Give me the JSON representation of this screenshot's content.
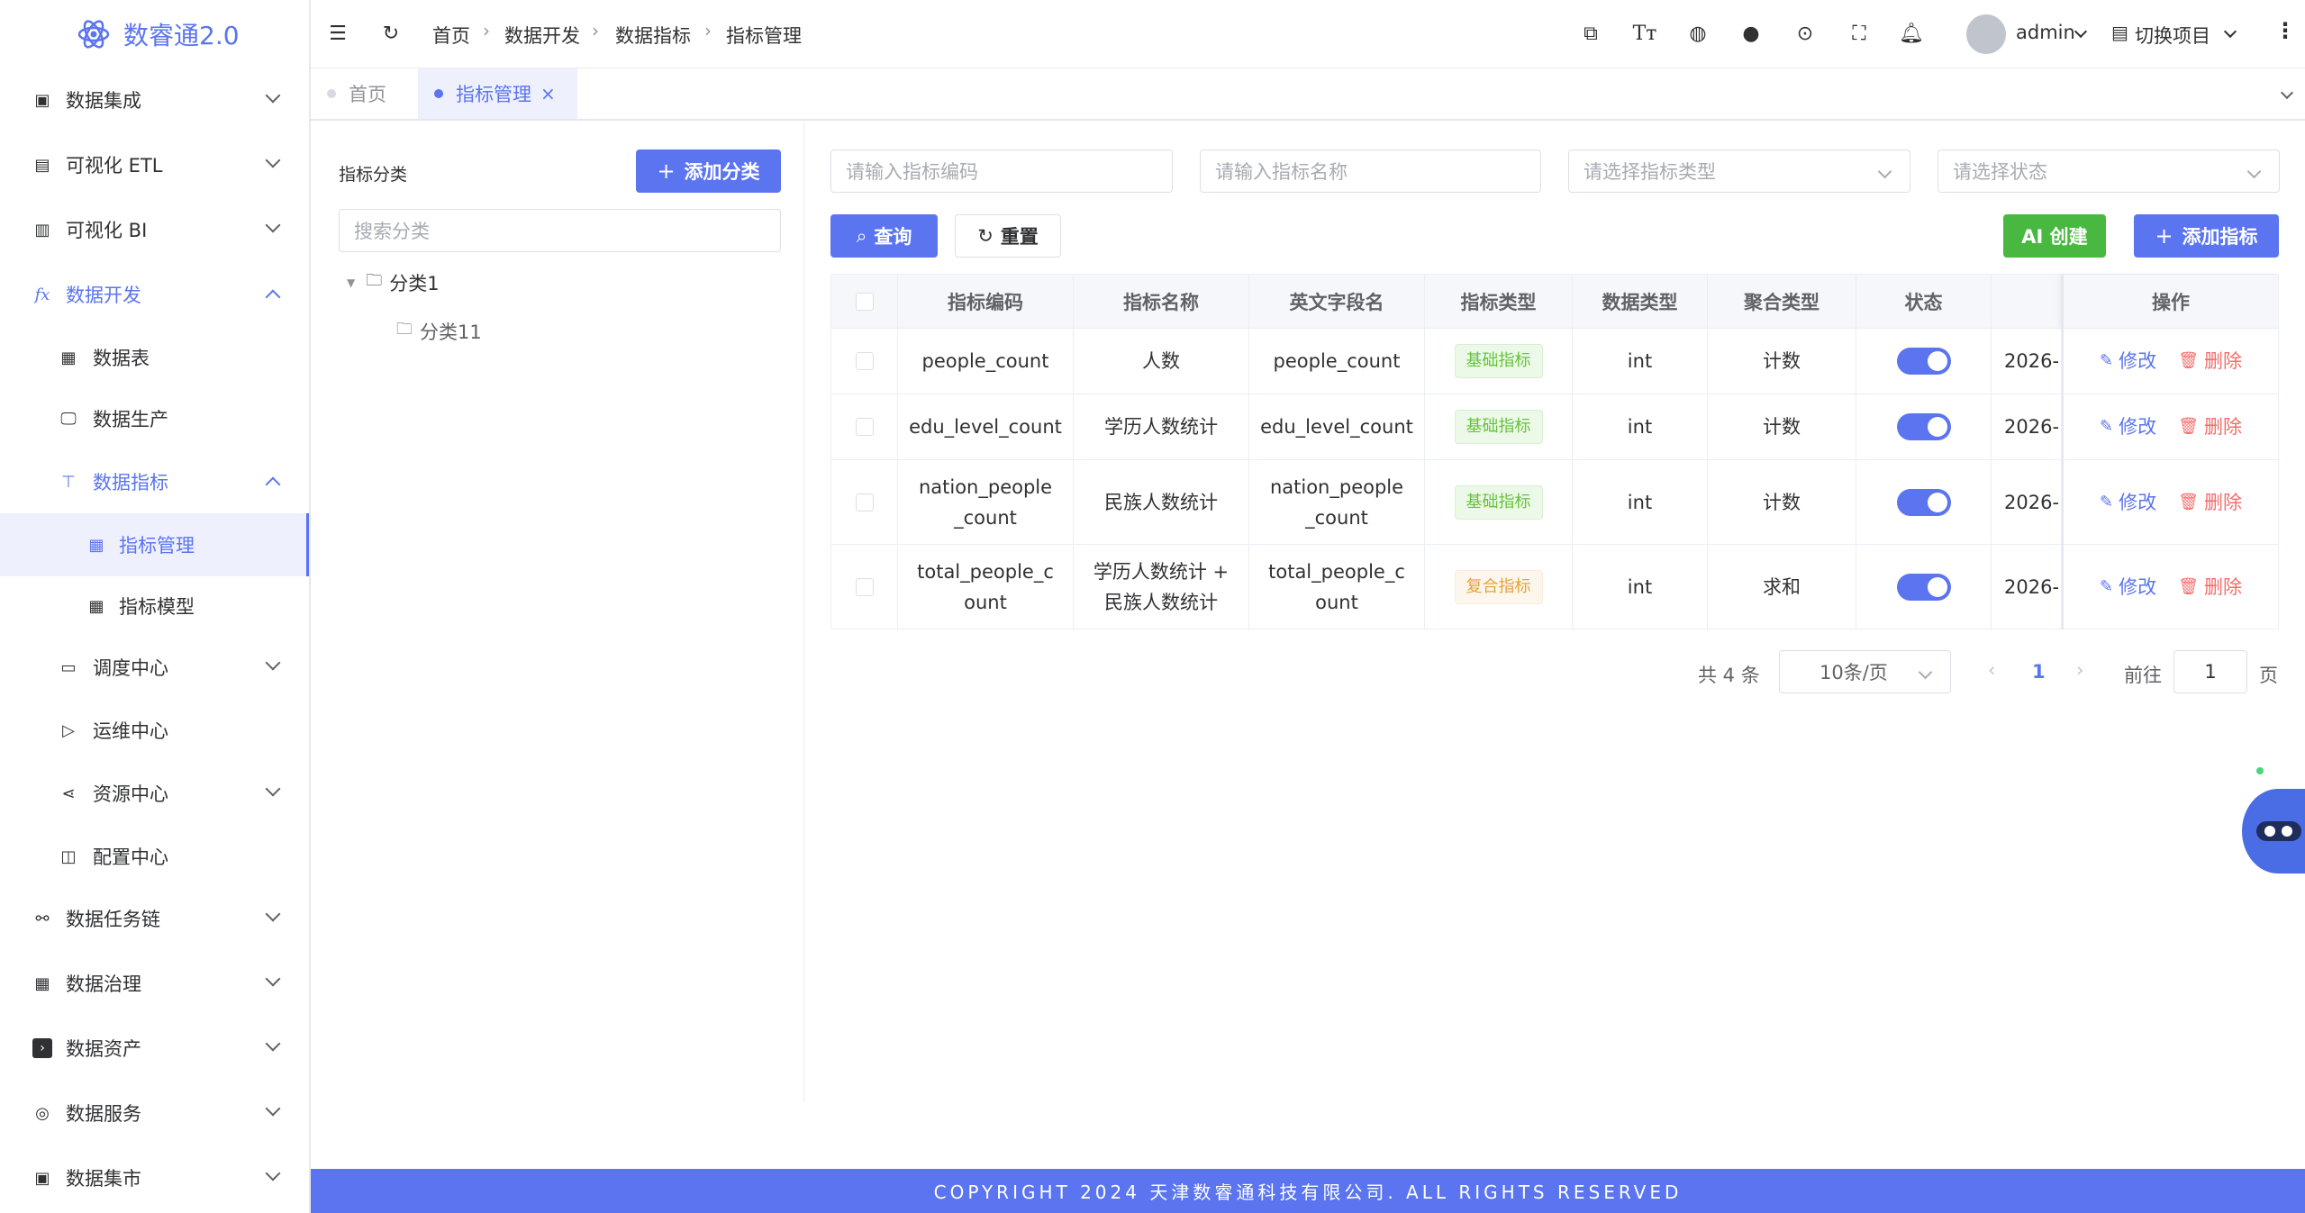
{
  "app": {
    "title": "数睿通2.0"
  },
  "sidebar": {
    "items": [
      {
        "label": "数据集成",
        "icon": "data-integration-icon"
      },
      {
        "label": "可视化 ETL",
        "icon": "etl-icon"
      },
      {
        "label": "可视化 BI",
        "icon": "bi-chart-icon"
      },
      {
        "label": "数据开发",
        "icon": "fx-icon"
      },
      {
        "label": "数据表",
        "icon": "table-icon"
      },
      {
        "label": "数据生产",
        "icon": "monitor-icon"
      },
      {
        "label": "数据指标",
        "icon": "paint-roller-icon"
      },
      {
        "label": "指标管理",
        "icon": "grid-icon"
      },
      {
        "label": "指标模型",
        "icon": "grid-icon"
      },
      {
        "label": "调度中心",
        "icon": "calendar-icon"
      },
      {
        "label": "运维中心",
        "icon": "send-icon"
      },
      {
        "label": "资源中心",
        "icon": "share-icon"
      },
      {
        "label": "配置中心",
        "icon": "frame-icon"
      },
      {
        "label": "数据任务链",
        "icon": "link-icon"
      },
      {
        "label": "数据治理",
        "icon": "grid-table-icon"
      },
      {
        "label": "数据资产",
        "icon": "terminal-icon"
      },
      {
        "label": "数据服务",
        "icon": "service-icon"
      },
      {
        "label": "数据集市",
        "icon": "market-icon"
      }
    ]
  },
  "header": {
    "breadcrumb": [
      "首页",
      "数据开发",
      "数据指标",
      "指标管理"
    ],
    "user": "admin",
    "switch_project": "切换项目"
  },
  "tabs": [
    {
      "label": "首页"
    },
    {
      "label": "指标管理"
    }
  ],
  "category": {
    "title": "指标分类",
    "add_button": "添加分类",
    "search_placeholder": "搜索分类",
    "tree": [
      {
        "label": "分类1"
      },
      {
        "label": "分类11"
      }
    ]
  },
  "filters": {
    "code_placeholder": "请输入指标编码",
    "name_placeholder": "请输入指标名称",
    "type_placeholder": "请选择指标类型",
    "status_placeholder": "请选择状态",
    "query_button": "查询",
    "reset_button": "重置",
    "ai_button": "AI 创建",
    "add_button": "添加指标"
  },
  "table": {
    "columns": [
      "指标编码",
      "指标名称",
      "英文字段名",
      "指标类型",
      "数据类型",
      "聚合类型",
      "状态",
      "",
      "操作"
    ],
    "rows": [
      {
        "code": "people_count",
        "name": "人数",
        "field": "people_count",
        "type": "基础指标",
        "dtype": "int",
        "agg": "计数",
        "status": true,
        "date": "2026-"
      },
      {
        "code": "edu_level_count",
        "name": "学历人数统计",
        "field": "edu_level_count",
        "type": "基础指标",
        "dtype": "int",
        "agg": "计数",
        "status": true,
        "date": "2026-"
      },
      {
        "code": "nation_people_count",
        "name": "民族人数统计",
        "field": "nation_people_count",
        "type": "基础指标",
        "dtype": "int",
        "agg": "计数",
        "status": true,
        "date": "2026-"
      },
      {
        "code": "total_people_count",
        "name": "学历人数统计 + 民族人数统计",
        "field": "total_people_count",
        "type": "复合指标",
        "dtype": "int",
        "agg": "求和",
        "status": true,
        "date": "2026-"
      }
    ],
    "edit_label": "修改",
    "delete_label": "删除"
  },
  "pagination": {
    "total": "共 4 条",
    "page_size": "10条/页",
    "current": "1",
    "goto_label": "前往",
    "goto_value": "1",
    "page_suffix": "页"
  },
  "footer": {
    "text": "COPYRIGHT 2024 天津数睿通科技有限公司. ALL RIGHTS RESERVED"
  },
  "colors": {
    "primary": "#5b74ef",
    "green": "#49b840",
    "danger": "#f56c6c"
  }
}
